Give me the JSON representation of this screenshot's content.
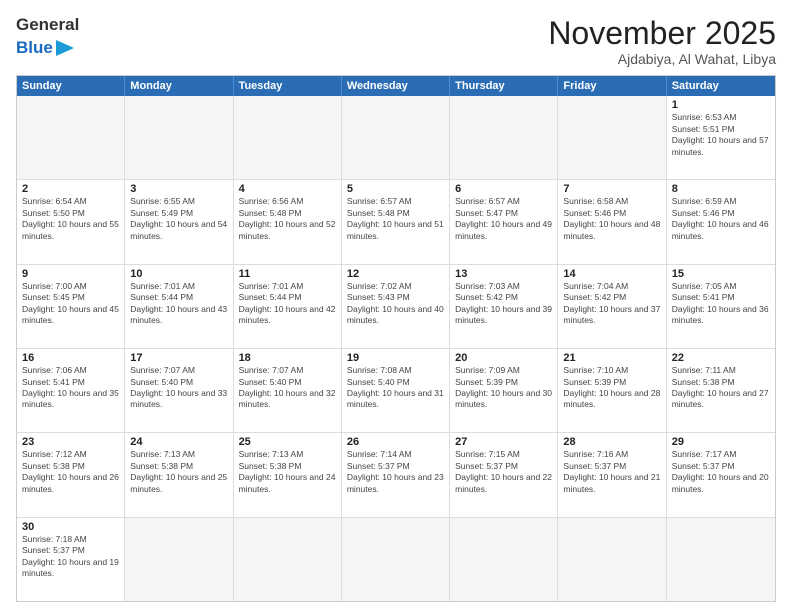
{
  "logo": {
    "general": "General",
    "blue": "Blue"
  },
  "header": {
    "month": "November 2025",
    "location": "Ajdabiya, Al Wahat, Libya"
  },
  "weekdays": [
    "Sunday",
    "Monday",
    "Tuesday",
    "Wednesday",
    "Thursday",
    "Friday",
    "Saturday"
  ],
  "rows": [
    [
      {
        "day": "",
        "text": ""
      },
      {
        "day": "",
        "text": ""
      },
      {
        "day": "",
        "text": ""
      },
      {
        "day": "",
        "text": ""
      },
      {
        "day": "",
        "text": ""
      },
      {
        "day": "",
        "text": ""
      },
      {
        "day": "1",
        "text": "Sunrise: 6:53 AM\nSunset: 5:51 PM\nDaylight: 10 hours and 57 minutes."
      }
    ],
    [
      {
        "day": "2",
        "text": "Sunrise: 6:54 AM\nSunset: 5:50 PM\nDaylight: 10 hours and 55 minutes."
      },
      {
        "day": "3",
        "text": "Sunrise: 6:55 AM\nSunset: 5:49 PM\nDaylight: 10 hours and 54 minutes."
      },
      {
        "day": "4",
        "text": "Sunrise: 6:56 AM\nSunset: 5:48 PM\nDaylight: 10 hours and 52 minutes."
      },
      {
        "day": "5",
        "text": "Sunrise: 6:57 AM\nSunset: 5:48 PM\nDaylight: 10 hours and 51 minutes."
      },
      {
        "day": "6",
        "text": "Sunrise: 6:57 AM\nSunset: 5:47 PM\nDaylight: 10 hours and 49 minutes."
      },
      {
        "day": "7",
        "text": "Sunrise: 6:58 AM\nSunset: 5:46 PM\nDaylight: 10 hours and 48 minutes."
      },
      {
        "day": "8",
        "text": "Sunrise: 6:59 AM\nSunset: 5:46 PM\nDaylight: 10 hours and 46 minutes."
      }
    ],
    [
      {
        "day": "9",
        "text": "Sunrise: 7:00 AM\nSunset: 5:45 PM\nDaylight: 10 hours and 45 minutes."
      },
      {
        "day": "10",
        "text": "Sunrise: 7:01 AM\nSunset: 5:44 PM\nDaylight: 10 hours and 43 minutes."
      },
      {
        "day": "11",
        "text": "Sunrise: 7:01 AM\nSunset: 5:44 PM\nDaylight: 10 hours and 42 minutes."
      },
      {
        "day": "12",
        "text": "Sunrise: 7:02 AM\nSunset: 5:43 PM\nDaylight: 10 hours and 40 minutes."
      },
      {
        "day": "13",
        "text": "Sunrise: 7:03 AM\nSunset: 5:42 PM\nDaylight: 10 hours and 39 minutes."
      },
      {
        "day": "14",
        "text": "Sunrise: 7:04 AM\nSunset: 5:42 PM\nDaylight: 10 hours and 37 minutes."
      },
      {
        "day": "15",
        "text": "Sunrise: 7:05 AM\nSunset: 5:41 PM\nDaylight: 10 hours and 36 minutes."
      }
    ],
    [
      {
        "day": "16",
        "text": "Sunrise: 7:06 AM\nSunset: 5:41 PM\nDaylight: 10 hours and 35 minutes."
      },
      {
        "day": "17",
        "text": "Sunrise: 7:07 AM\nSunset: 5:40 PM\nDaylight: 10 hours and 33 minutes."
      },
      {
        "day": "18",
        "text": "Sunrise: 7:07 AM\nSunset: 5:40 PM\nDaylight: 10 hours and 32 minutes."
      },
      {
        "day": "19",
        "text": "Sunrise: 7:08 AM\nSunset: 5:40 PM\nDaylight: 10 hours and 31 minutes."
      },
      {
        "day": "20",
        "text": "Sunrise: 7:09 AM\nSunset: 5:39 PM\nDaylight: 10 hours and 30 minutes."
      },
      {
        "day": "21",
        "text": "Sunrise: 7:10 AM\nSunset: 5:39 PM\nDaylight: 10 hours and 28 minutes."
      },
      {
        "day": "22",
        "text": "Sunrise: 7:11 AM\nSunset: 5:38 PM\nDaylight: 10 hours and 27 minutes."
      }
    ],
    [
      {
        "day": "23",
        "text": "Sunrise: 7:12 AM\nSunset: 5:38 PM\nDaylight: 10 hours and 26 minutes."
      },
      {
        "day": "24",
        "text": "Sunrise: 7:13 AM\nSunset: 5:38 PM\nDaylight: 10 hours and 25 minutes."
      },
      {
        "day": "25",
        "text": "Sunrise: 7:13 AM\nSunset: 5:38 PM\nDaylight: 10 hours and 24 minutes."
      },
      {
        "day": "26",
        "text": "Sunrise: 7:14 AM\nSunset: 5:37 PM\nDaylight: 10 hours and 23 minutes."
      },
      {
        "day": "27",
        "text": "Sunrise: 7:15 AM\nSunset: 5:37 PM\nDaylight: 10 hours and 22 minutes."
      },
      {
        "day": "28",
        "text": "Sunrise: 7:16 AM\nSunset: 5:37 PM\nDaylight: 10 hours and 21 minutes."
      },
      {
        "day": "29",
        "text": "Sunrise: 7:17 AM\nSunset: 5:37 PM\nDaylight: 10 hours and 20 minutes."
      }
    ],
    [
      {
        "day": "30",
        "text": "Sunrise: 7:18 AM\nSunset: 5:37 PM\nDaylight: 10 hours and 19 minutes."
      },
      {
        "day": "",
        "text": ""
      },
      {
        "day": "",
        "text": ""
      },
      {
        "day": "",
        "text": ""
      },
      {
        "day": "",
        "text": ""
      },
      {
        "day": "",
        "text": ""
      },
      {
        "day": "",
        "text": ""
      }
    ]
  ]
}
